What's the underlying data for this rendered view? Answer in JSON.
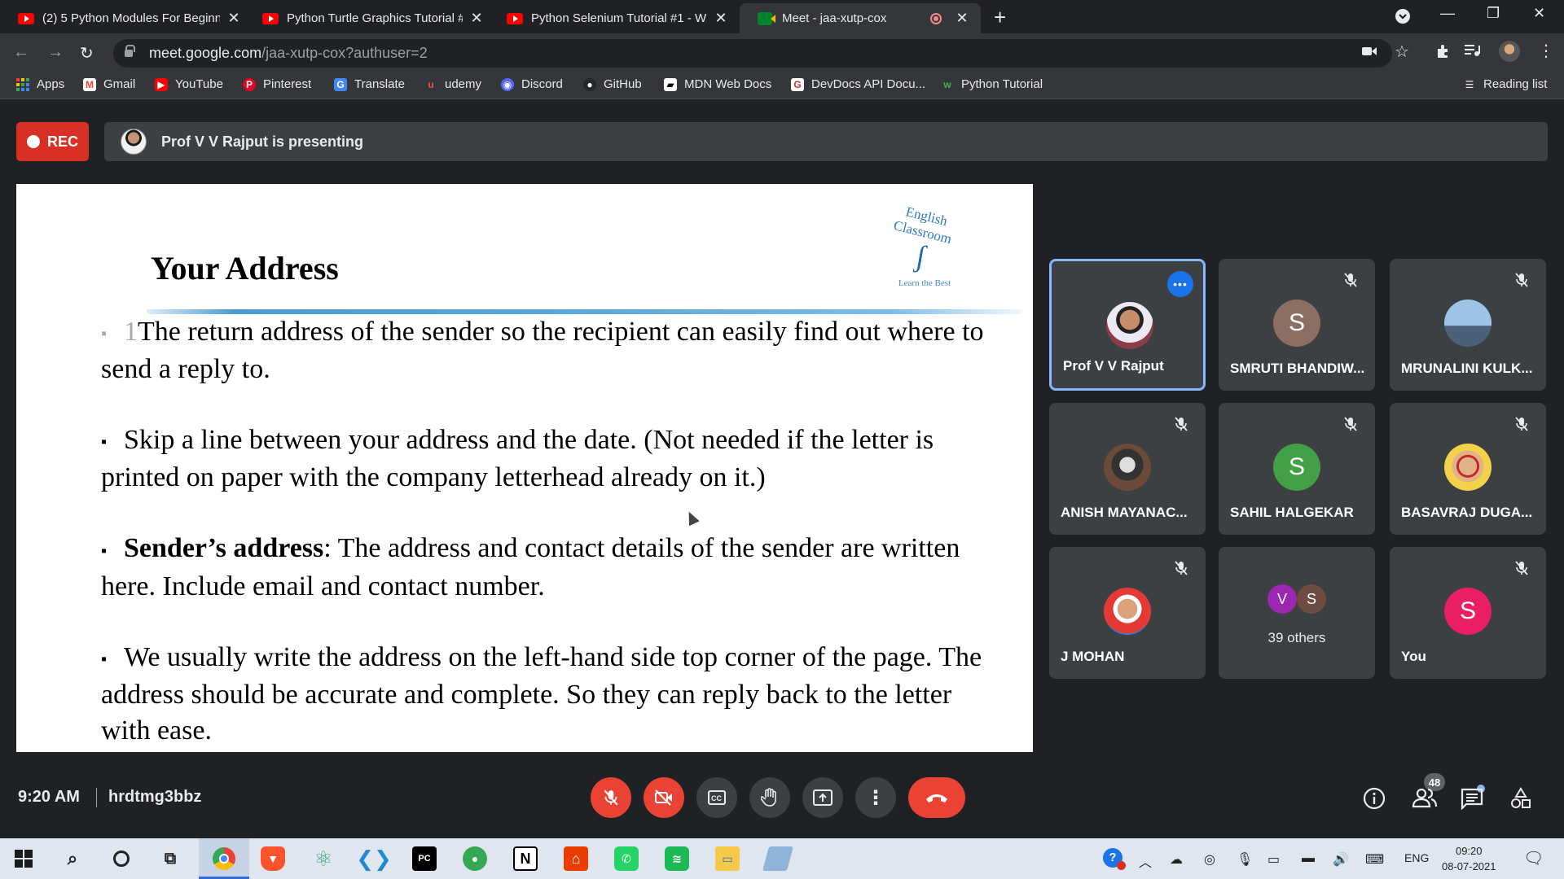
{
  "browser": {
    "tabs": [
      {
        "title": "(2) 5 Python Modules For Beginn",
        "favicon": "youtube-icon",
        "active": false
      },
      {
        "title": "Python Turtle Graphics Tutorial #",
        "favicon": "youtube-icon",
        "active": false
      },
      {
        "title": "Python Selenium Tutorial #1 - W",
        "favicon": "youtube-icon",
        "active": false
      },
      {
        "title": "Meet - jaa-xutp-cox",
        "favicon": "google-meet-icon",
        "active": true
      }
    ],
    "url_host": "meet.google.com",
    "url_path": "/jaa-xutp-cox?authuser=2",
    "bookmarks": [
      {
        "label": "Apps",
        "icon": "apps-grid-icon"
      },
      {
        "label": "Gmail",
        "icon": "gmail-icon"
      },
      {
        "label": "YouTube",
        "icon": "youtube-icon"
      },
      {
        "label": "Pinterest",
        "icon": "pinterest-icon"
      },
      {
        "label": "Translate",
        "icon": "translate-icon"
      },
      {
        "label": "udemy",
        "icon": "udemy-icon"
      },
      {
        "label": "Discord",
        "icon": "discord-icon"
      },
      {
        "label": "GitHub",
        "icon": "github-icon"
      },
      {
        "label": "MDN Web Docs",
        "icon": "mdn-icon"
      },
      {
        "label": "DevDocs API Docu...",
        "icon": "devdocs-icon"
      },
      {
        "label": "Python Tutorial",
        "icon": "w3schools-icon"
      }
    ],
    "reading_list": "Reading list"
  },
  "meet": {
    "rec_label": "REC",
    "presenting_text": "Prof V V Rajput is presenting",
    "slide": {
      "title": "Your Address",
      "logo_arc_text": "English Classroom",
      "logo_tagline": "Learn the Best",
      "para1_num": "1",
      "para1": "The return address of the sender so the recipient can easily find out where to send a reply to.",
      "para2": "Skip a line between your address and the date. (Not needed if the letter is printed on paper with the company letterhead already on it.)",
      "para3_bold": "Sender’s address",
      "para3": ": The address and contact details of the sender are written here. Include email and contact number.",
      "para4": "We usually write the address on the left-hand side top corner of the page. The address should be accurate and complete. So they can reply back to the letter with ease."
    },
    "participants": [
      {
        "name": "Prof V V Rajput",
        "avatar": "photo",
        "muted": false,
        "speaking": true
      },
      {
        "name": "SMRUTI BHANDIW...",
        "avatar": "S",
        "color": "#8d6e63",
        "muted": true
      },
      {
        "name": "MRUNALINI KULK...",
        "avatar": "photo",
        "muted": true
      },
      {
        "name": "ANISH MAYANAC...",
        "avatar": "photo",
        "muted": true
      },
      {
        "name": "SAHIL HALGEKAR",
        "avatar": "S",
        "color": "#43a047",
        "muted": true
      },
      {
        "name": "BASAVRAJ DUGA...",
        "avatar": "photo",
        "muted": true
      },
      {
        "name": "J MOHAN",
        "avatar": "photo",
        "muted": true
      },
      {
        "name": "39 others",
        "mini_avatars": [
          "V",
          "S"
        ]
      },
      {
        "name": "You",
        "avatar": "S",
        "color": "#e91e63",
        "muted": true
      }
    ],
    "time": "9:20 AM",
    "meeting_code": "hrdtmg3bbz",
    "people_count": "48"
  },
  "taskbar": {
    "language": "ENG",
    "clock_time": "09:20",
    "clock_date": "08-07-2021"
  }
}
